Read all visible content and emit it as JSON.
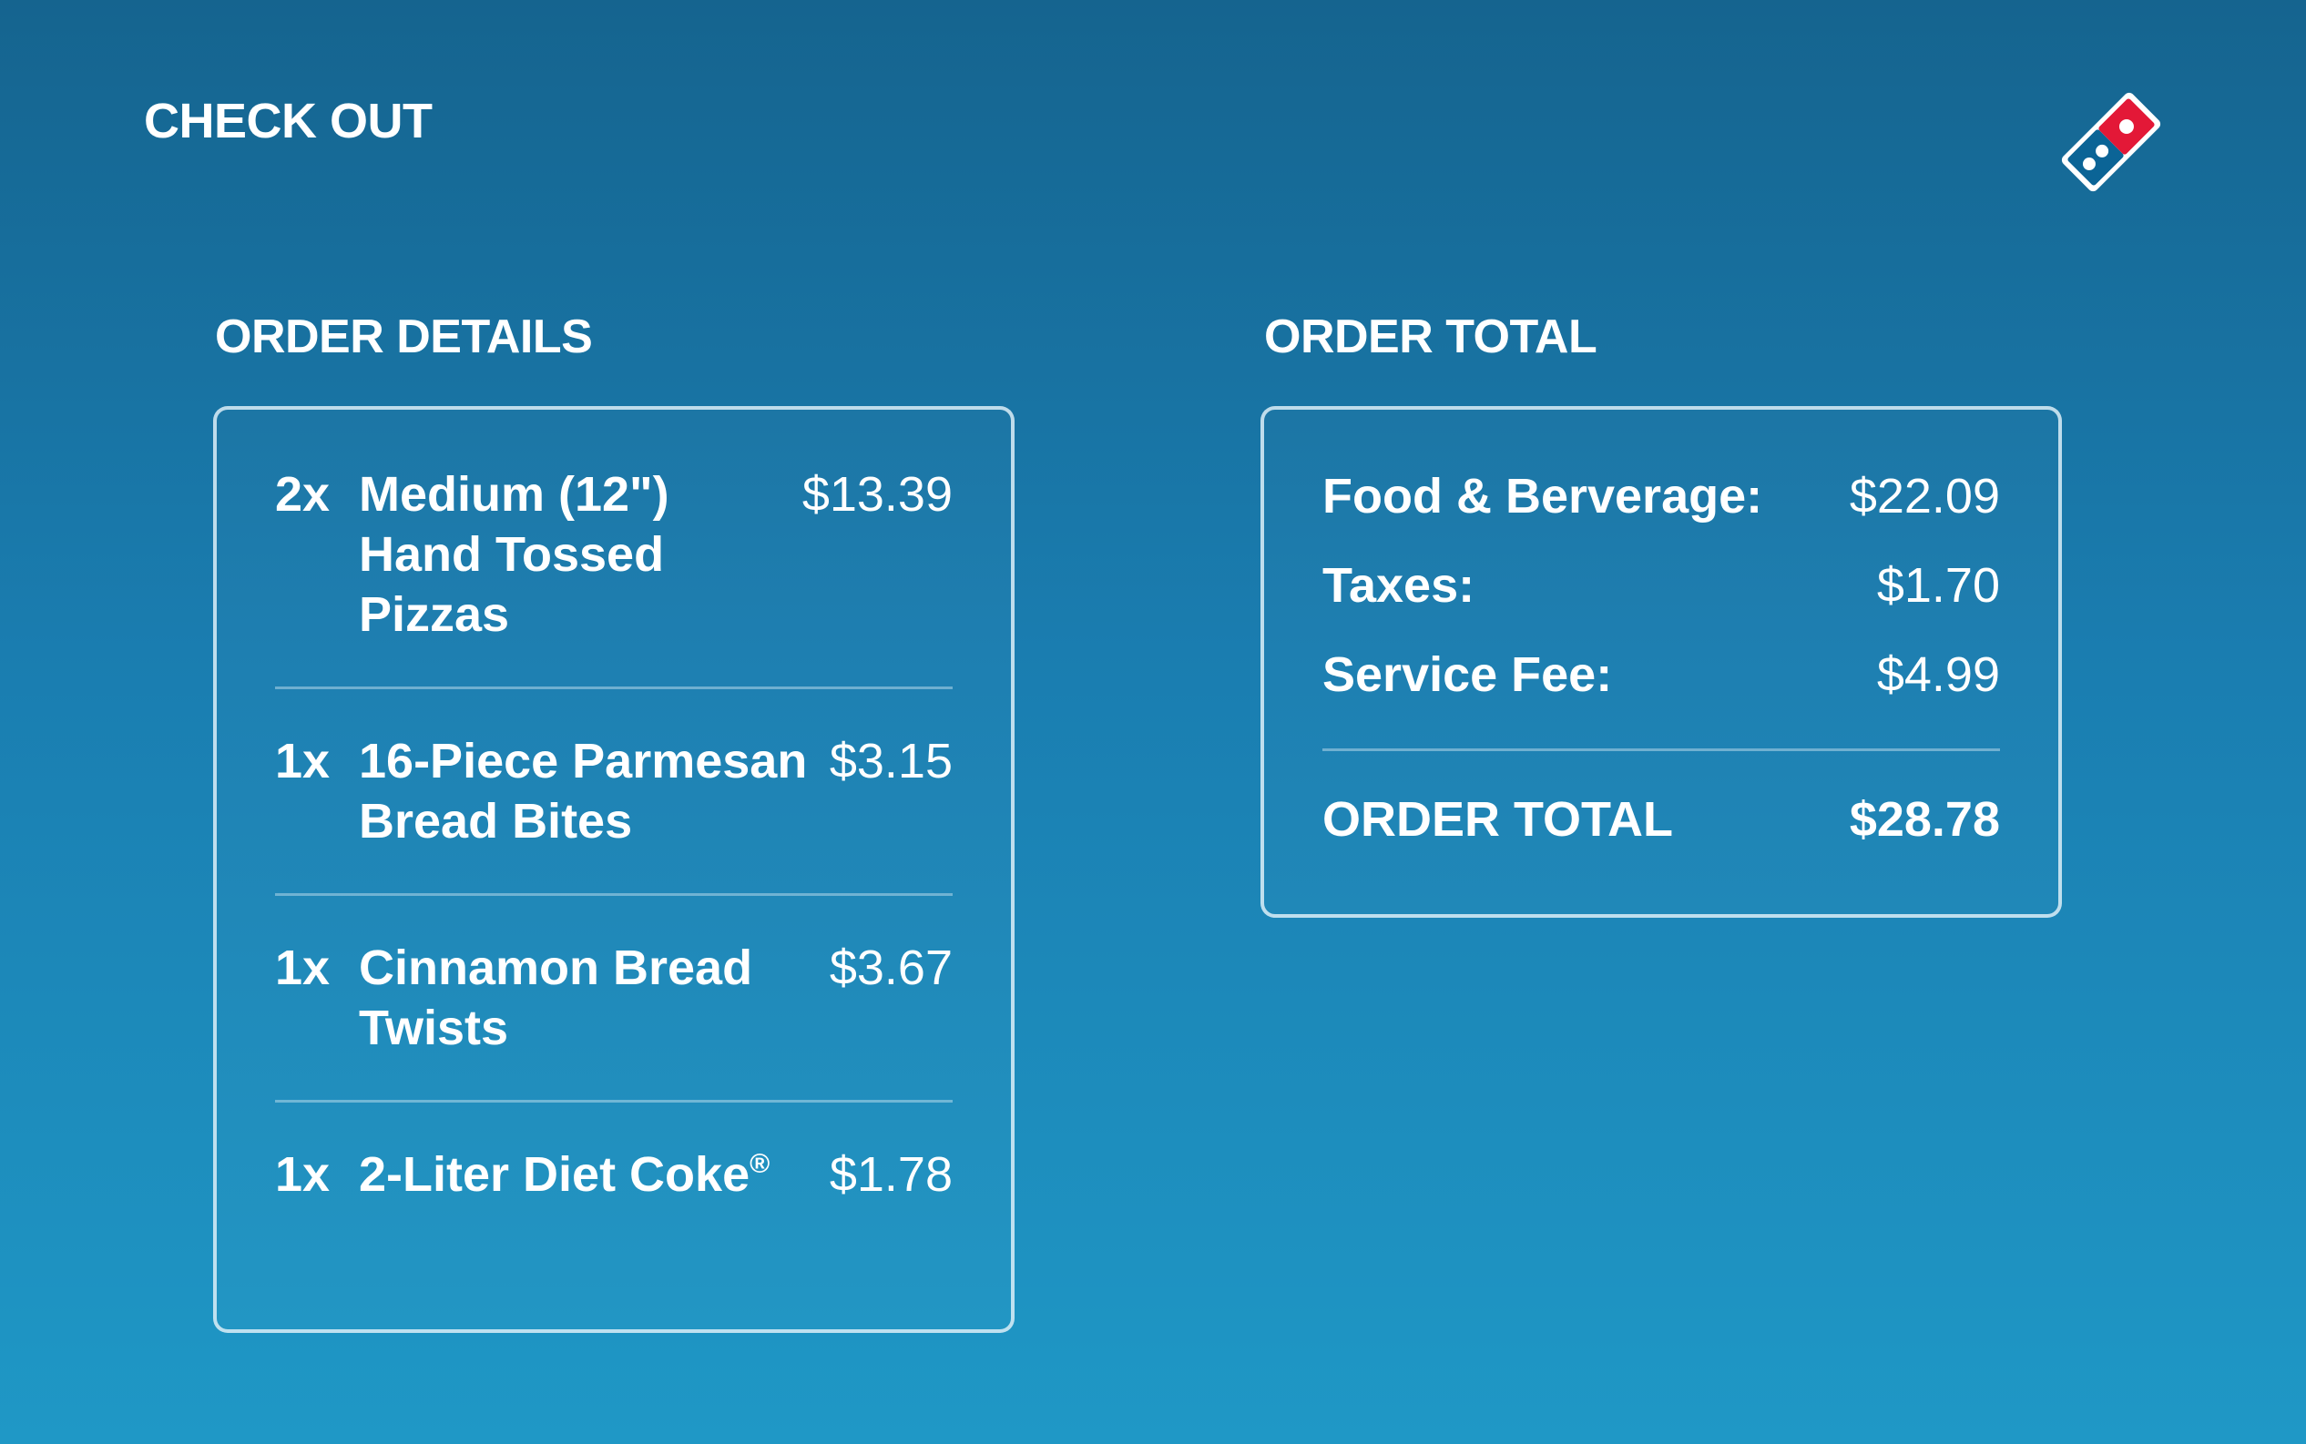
{
  "header": {
    "title": "CHECK OUT",
    "logo_icon": "dominos-domino-logo-icon"
  },
  "order_details": {
    "title": "ORDER DETAILS",
    "items": [
      {
        "qty": "2x",
        "name": "Medium (12\") Hand Tossed Pizzas",
        "price": "$13.39"
      },
      {
        "qty": "1x",
        "name": "16-Piece Parmesan Bread Bites",
        "price": "$3.15"
      },
      {
        "qty": "1x",
        "name": "Cinnamon Bread Twists",
        "price": "$3.67"
      },
      {
        "qty": "1x",
        "name": "2-Liter Diet Coke",
        "name_mark": "®",
        "price": "$1.78"
      }
    ]
  },
  "order_total": {
    "title": "ORDER TOTAL",
    "lines": [
      {
        "label": "Food & Berverage:",
        "amount": "$22.09"
      },
      {
        "label": "Taxes:",
        "amount": "$1.70"
      },
      {
        "label": "Service Fee:",
        "amount": "$4.99"
      }
    ],
    "grand_label": "ORDER TOTAL",
    "grand_amount": "$28.78"
  },
  "colors": {
    "background_top": "#15648f",
    "background_bottom": "#1f98c6",
    "logo_red": "#e31837",
    "logo_blue": "#0b6496"
  }
}
